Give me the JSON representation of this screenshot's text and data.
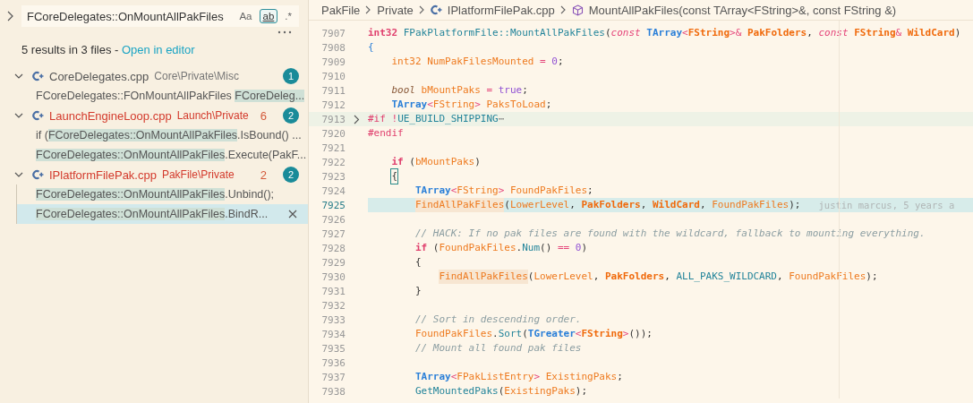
{
  "search": {
    "value": "FCoreDelegates::OnMountAllPakFiles",
    "toggles": [
      {
        "label": "Aa",
        "selected": false
      },
      {
        "label": "ab",
        "selected": true
      },
      {
        "label": ".*",
        "selected": false
      }
    ]
  },
  "summary": {
    "text": "5 results in 3 files - ",
    "link": "Open in editor"
  },
  "files": [
    {
      "name": "CoreDelegates.cpp",
      "path": "Core\\Private\\Misc",
      "error": false,
      "count": "1",
      "expanded": true,
      "matches": [
        {
          "before": "FCoreDelegates::FOnMountAllPakFiles ",
          "match": "FCoreDeleg...",
          "selected": false
        }
      ]
    },
    {
      "name": "LaunchEngineLoop.cpp",
      "path": "Launch\\Private",
      "error": true,
      "problems": "6",
      "count": "2",
      "expanded": true,
      "matches": [
        {
          "before": "if (",
          "match": "FCoreDelegates::OnMountAllPakFiles",
          "after": ".IsBound() ...",
          "selected": false
        },
        {
          "match": "FCoreDelegates::OnMountAllPakFiles",
          "after": ".Execute(PakF...",
          "selected": false
        }
      ]
    },
    {
      "name": "IPlatformFilePak.cpp",
      "path": "PakFile\\Private",
      "error": true,
      "problems": "2",
      "count": "2",
      "expanded": true,
      "matches": [
        {
          "match": "FCoreDelegates::OnMountAllPakFiles",
          "after": ".Unbind();",
          "selected": false
        },
        {
          "match": "FCoreDelegates::OnMountAllPakFiles",
          "after": ".BindR...",
          "selected": true
        }
      ]
    }
  ],
  "breadcrumb": [
    {
      "label": "PakFile",
      "kind": "folder"
    },
    {
      "label": "Private",
      "kind": "folder"
    },
    {
      "label": "IPlatformFilePak.cpp",
      "kind": "file"
    },
    {
      "label": "MountAllPakFiles(const TArray<FString>&, const FString &)",
      "kind": "symbol"
    }
  ],
  "lines": [
    {
      "number": "7907",
      "tokens": [
        {
          "text": "int32 ",
          "kind": "prim"
        },
        {
          "text": "FPakPlatformFile::MountAllPakFiles",
          "kind": "fn"
        },
        {
          "text": "(",
          "kind": "punct"
        },
        {
          "text": "const ",
          "kind": "kw"
        },
        {
          "text": "TArray",
          "kind": "type"
        },
        {
          "text": "<",
          "kind": "op"
        },
        {
          "text": "FString",
          "kind": "param"
        },
        {
          "text": ">&",
          "kind": "op"
        },
        {
          "text": " PakFolders",
          "kind": "param"
        },
        {
          "text": ", ",
          "kind": "punct"
        },
        {
          "text": "const ",
          "kind": "kw"
        },
        {
          "text": "FString",
          "kind": "param"
        },
        {
          "text": "&",
          "kind": "op"
        },
        {
          "text": " WildCard",
          "kind": "param"
        },
        {
          "text": ")",
          "kind": "punct"
        }
      ]
    },
    {
      "number": "7908",
      "tokens": [
        {
          "text": "{",
          "kind": "brace"
        }
      ]
    },
    {
      "children": [
        {
          "number": "7909",
          "tokens": [
            {
              "text": "int32 NumPakFilesMounted ",
              "kind": "var"
            },
            {
              "text": "= ",
              "kind": "op"
            },
            {
              "text": "0",
              "kind": "num"
            },
            {
              "text": ";",
              "kind": "punct"
            }
          ]
        },
        {
          "number": "7910"
        },
        {
          "number": "7911",
          "tokens": [
            {
              "text": "bool ",
              "kind": "kw2"
            },
            {
              "text": "bMountPaks ",
              "kind": "var"
            },
            {
              "text": "= ",
              "kind": "op"
            },
            {
              "text": "true",
              "kind": "num"
            },
            {
              "text": ";",
              "kind": "punct"
            }
          ]
        },
        {
          "number": "7912",
          "tokens": [
            {
              "text": "TArray",
              "kind": "type"
            },
            {
              "text": "<",
              "kind": "op"
            },
            {
              "text": "FString",
              "kind": "var"
            },
            {
              "text": ">",
              "kind": "op"
            },
            {
              "text": " PaksToLoad",
              "kind": "var"
            },
            {
              "text": ";",
              "kind": "punct"
            }
          ]
        }
      ]
    },
    {
      "number": "7913",
      "folded": true,
      "tokens": [
        {
          "text": "#if ",
          "kind": "macro"
        },
        {
          "text": "!",
          "kind": "op"
        },
        {
          "text": "UE_BUILD_SHIPPING",
          "kind": "fn"
        },
        {
          "text": "⋯",
          "kind": "fold"
        }
      ]
    },
    {
      "number": "7920",
      "tokens": [
        {
          "text": "#endif",
          "kind": "macro"
        }
      ]
    },
    {
      "children": [
        {
          "number": "7921"
        },
        {
          "number": "7922",
          "tokens": [
            {
              "text": "if ",
              "kind": "prim"
            },
            {
              "text": "(",
              "kind": "punct"
            },
            {
              "text": "bMountPaks",
              "kind": "var"
            },
            {
              "text": ")",
              "kind": "punct"
            }
          ]
        },
        {
          "number": "7923",
          "tokens": [
            {
              "text": "{",
              "kind": "bracket"
            }
          ]
        },
        {
          "children": [
            {
              "number": "7924",
              "tokens": [
                {
                  "text": "TArray",
                  "kind": "type"
                },
                {
                  "text": "<",
                  "kind": "op"
                },
                {
                  "text": "FString",
                  "kind": "var"
                },
                {
                  "text": ">",
                  "kind": "op"
                },
                {
                  "text": " FoundPakFiles",
                  "kind": "var"
                },
                {
                  "text": ";",
                  "kind": "punct"
                }
              ]
            },
            {
              "number": "7925",
              "current": true,
              "blame": "justin marcus, 5 years a",
              "tokens": [
                {
                  "text": "FindAllPakFiles",
                  "kind": "match"
                },
                {
                  "text": "(",
                  "kind": "punct"
                },
                {
                  "text": "LowerLevel",
                  "kind": "var"
                },
                {
                  "text": ", ",
                  "kind": "punct"
                },
                {
                  "text": "PakFolders",
                  "kind": "param"
                },
                {
                  "text": ", ",
                  "kind": "punct"
                },
                {
                  "text": "WildCard",
                  "kind": "param"
                },
                {
                  "text": ", ",
                  "kind": "punct"
                },
                {
                  "text": "FoundPakFiles",
                  "kind": "var"
                },
                {
                  "text": ");",
                  "kind": "punct"
                }
              ]
            },
            {
              "number": "7926"
            },
            {
              "number": "7927",
              "tokens": [
                {
                  "text": "// HACK: If no pak files are found with the wildcard, fallback to mounting everything.",
                  "kind": "comment"
                }
              ]
            },
            {
              "number": "7928",
              "tokens": [
                {
                  "text": "if ",
                  "kind": "prim"
                },
                {
                  "text": "(",
                  "kind": "punct"
                },
                {
                  "text": "FoundPakFiles",
                  "kind": "var"
                },
                {
                  "text": ".",
                  "kind": "punct"
                },
                {
                  "text": "Num",
                  "kind": "fn"
                },
                {
                  "text": "() ",
                  "kind": "punct"
                },
                {
                  "text": "== ",
                  "kind": "op"
                },
                {
                  "text": "0",
                  "kind": "num"
                },
                {
                  "text": ")",
                  "kind": "punct"
                }
              ]
            },
            {
              "number": "7929",
              "tokens": [
                {
                  "text": "{",
                  "kind": "punct"
                }
              ]
            },
            {
              "children": [
                {
                  "number": "7930",
                  "tokens": [
                    {
                      "text": "FindAllPakFiles",
                      "kind": "match"
                    },
                    {
                      "text": "(",
                      "kind": "punct"
                    },
                    {
                      "text": "LowerLevel",
                      "kind": "var"
                    },
                    {
                      "text": ", ",
                      "kind": "punct"
                    },
                    {
                      "text": "PakFolders",
                      "kind": "param"
                    },
                    {
                      "text": ", ",
                      "kind": "punct"
                    },
                    {
                      "text": "ALL_PAKS_WILDCARD",
                      "kind": "fn"
                    },
                    {
                      "text": ", ",
                      "kind": "punct"
                    },
                    {
                      "text": "FoundPakFiles",
                      "kind": "var"
                    },
                    {
                      "text": ");",
                      "kind": "punct"
                    }
                  ]
                }
              ]
            },
            {
              "number": "7931",
              "tokens": [
                {
                  "text": "}",
                  "kind": "punct"
                }
              ]
            },
            {
              "number": "7932"
            },
            {
              "number": "7933",
              "tokens": [
                {
                  "text": "// Sort in descending order.",
                  "kind": "comment"
                }
              ]
            },
            {
              "number": "7934",
              "tokens": [
                {
                  "text": "FoundPakFiles",
                  "kind": "var"
                },
                {
                  "text": ".",
                  "kind": "punct"
                },
                {
                  "text": "Sort",
                  "kind": "fn"
                },
                {
                  "text": "(",
                  "kind": "punct"
                },
                {
                  "text": "TGreater",
                  "kind": "type"
                },
                {
                  "text": "<",
                  "kind": "op"
                },
                {
                  "text": "FString",
                  "kind": "param"
                },
                {
                  "text": ">",
                  "kind": "op"
                },
                {
                  "text": "());",
                  "kind": "punct"
                }
              ]
            },
            {
              "number": "7935",
              "tokens": [
                {
                  "text": "// Mount all found pak files",
                  "kind": "comment"
                }
              ]
            },
            {
              "number": "7936"
            },
            {
              "number": "7937",
              "tokens": [
                {
                  "text": "TArray",
                  "kind": "type"
                },
                {
                  "text": "<",
                  "kind": "op"
                },
                {
                  "text": "FPakListEntry",
                  "kind": "var"
                },
                {
                  "text": ">",
                  "kind": "op"
                },
                {
                  "text": " ExistingPaks",
                  "kind": "var"
                },
                {
                  "text": ";",
                  "kind": "punct"
                }
              ]
            },
            {
              "number": "7938",
              "tokens": [
                {
                  "text": "GetMountedPaks",
                  "kind": "fn"
                },
                {
                  "text": "(",
                  "kind": "punct"
                },
                {
                  "text": "ExistingPaks",
                  "kind": "var"
                },
                {
                  "text": ");",
                  "kind": "punct"
                }
              ]
            }
          ]
        }
      ]
    }
  ]
}
